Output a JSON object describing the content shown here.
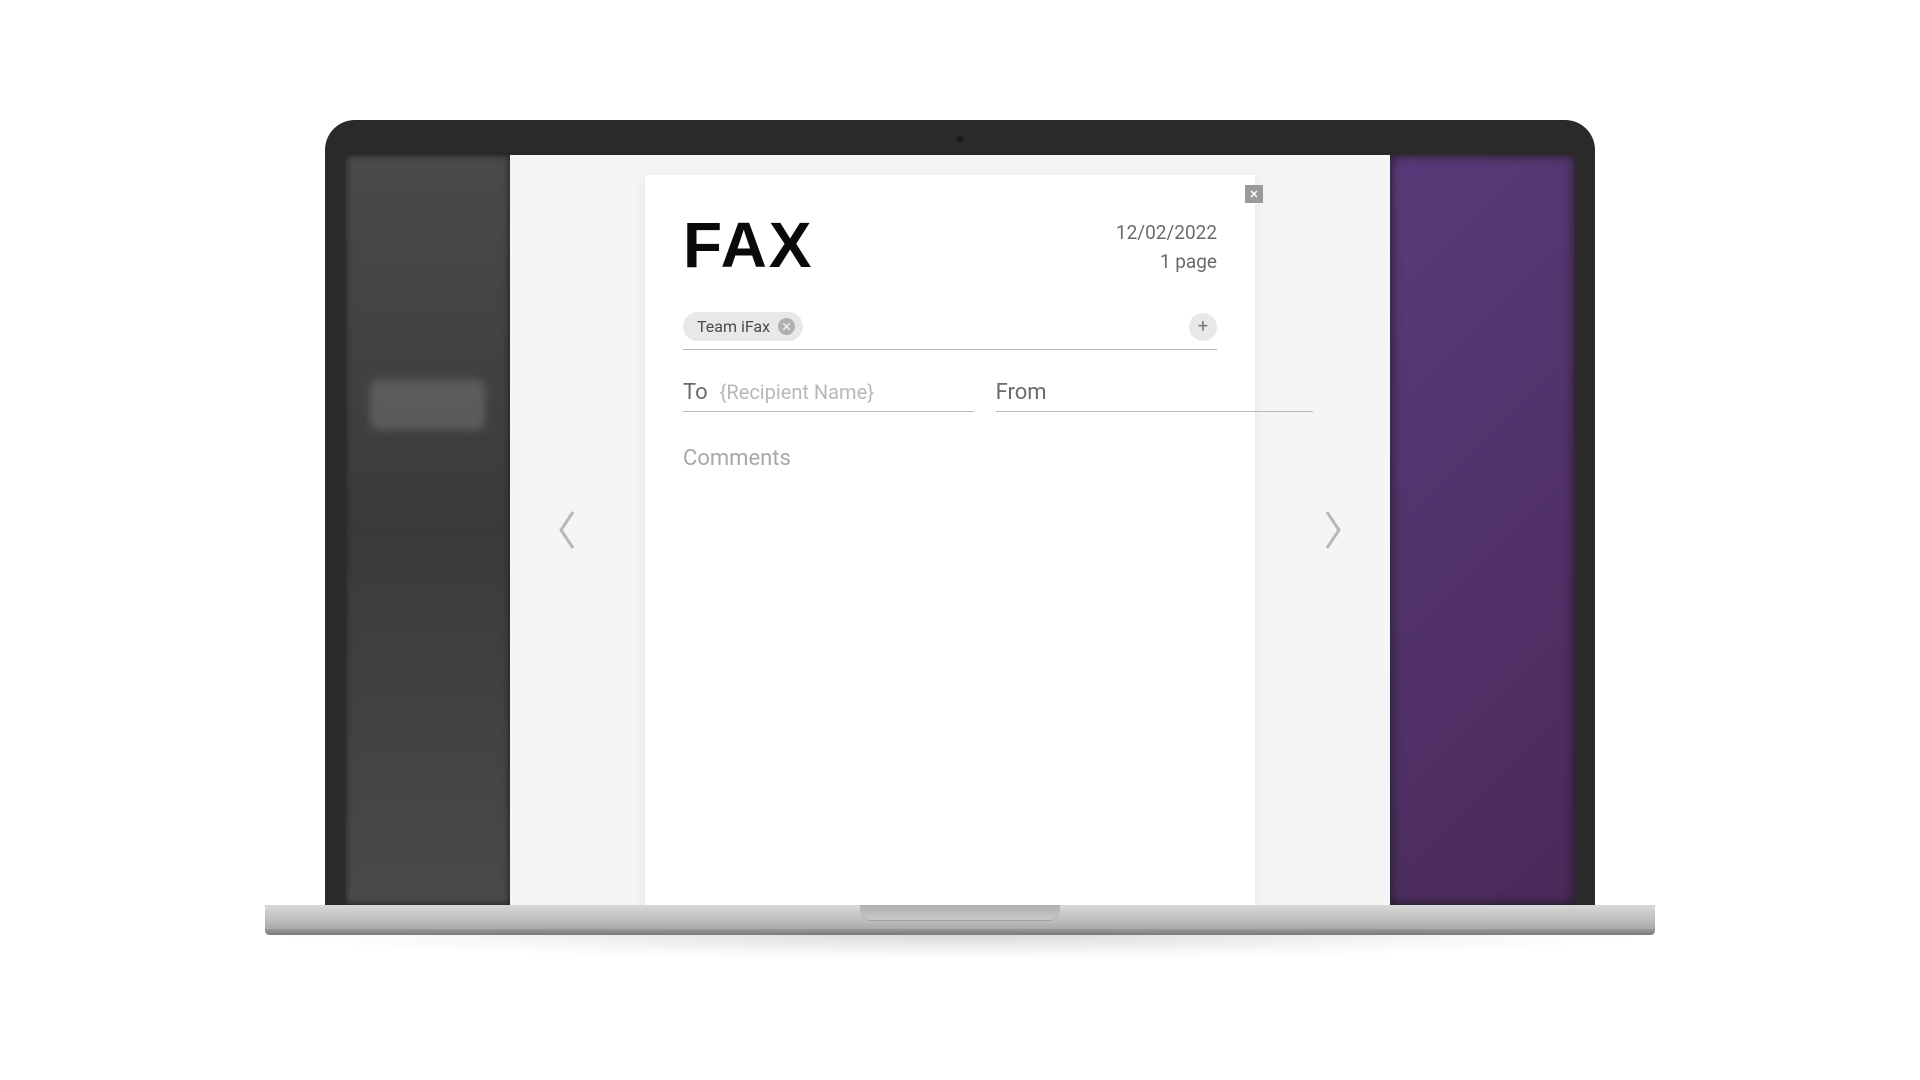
{
  "fax": {
    "title": "FAX",
    "date": "12/02/2022",
    "pages": "1 page",
    "recipients": [
      {
        "name": "Team iFax"
      }
    ],
    "to_label": "To",
    "to_placeholder": "{Recipient Name}",
    "from_label": "From",
    "comments_label": "Comments"
  }
}
